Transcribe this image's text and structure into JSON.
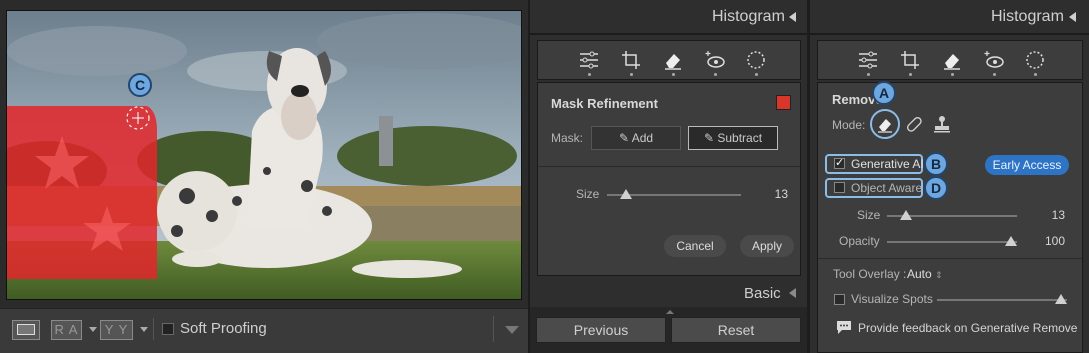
{
  "toolbar": {
    "loupe_label": "",
    "ra_label": "R A",
    "yy_label": "Y Y",
    "soft_proofing_label": "Soft Proofing"
  },
  "callouts": {
    "a": "A",
    "b": "B",
    "c": "C",
    "d": "D"
  },
  "mid_panel": {
    "histogram_label": "Histogram",
    "mask_refinement_title": "Mask Refinement",
    "mask_label": "Mask:",
    "add_label": "Add",
    "subtract_label": "Subtract",
    "size_label": "Size",
    "size_value": "13",
    "size_fraction": 0.15,
    "cancel_label": "Cancel",
    "apply_label": "Apply",
    "basic_label": "Basic",
    "previous_label": "Previous",
    "reset_label": "Reset",
    "mask_color": "#d9362b"
  },
  "right_panel": {
    "histogram_label": "Histogram",
    "remove_title": "Remove",
    "mode_label": "Mode:",
    "generative_ai_label": "Generative AI",
    "generative_ai_checked": true,
    "early_access_label": "Early Access",
    "object_aware_label": "Object Aware",
    "object_aware_checked": false,
    "size_label": "Size",
    "size_value": "13",
    "size_fraction": 0.15,
    "opacity_label": "Opacity",
    "opacity_value": "100",
    "opacity_fraction": 1.0,
    "tool_overlay_label": "Tool Overlay :",
    "tool_overlay_value": "Auto",
    "visualize_spots_label": "Visualize Spots",
    "feedback_label": "Provide feedback on Generative Remove",
    "accent_color": "#2d74c5"
  }
}
